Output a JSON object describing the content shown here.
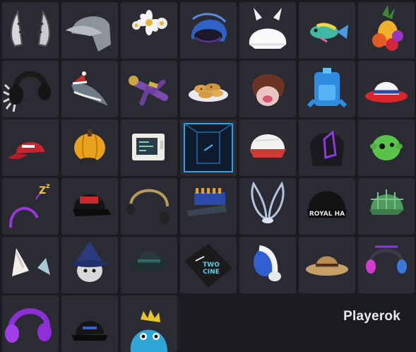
{
  "watermark": {
    "text": "Playerok"
  },
  "items": [
    {
      "icon": "horn-accessory-icon"
    },
    {
      "icon": "gray-hood-cap-icon"
    },
    {
      "icon": "daisy-flower-crown-icon"
    },
    {
      "icon": "blue-knit-helmet-icon"
    },
    {
      "icon": "white-devil-horns-icon"
    },
    {
      "icon": "rainbow-fish-icon"
    },
    {
      "icon": "fruit-hat-icon"
    },
    {
      "icon": "spiked-headphones-icon"
    },
    {
      "icon": "santa-shark-icon"
    },
    {
      "icon": "flying-ninja-icon"
    },
    {
      "icon": "cookie-plate-icon"
    },
    {
      "icon": "brown-hair-face-icon"
    },
    {
      "icon": "blue-backpack-icon"
    },
    {
      "icon": "white-red-fedora-icon"
    },
    {
      "icon": "red-cap-icon"
    },
    {
      "icon": "pumpkin-icon"
    },
    {
      "icon": "retro-computer-icon"
    },
    {
      "icon": "blue-box-icon"
    },
    {
      "icon": "white-red-cap-icon"
    },
    {
      "icon": "purple-visor-helmet-icon"
    },
    {
      "icon": "green-alien-head-icon"
    },
    {
      "icon": "sleepy-headband-icon"
    },
    {
      "icon": "black-stp-cap-icon"
    },
    {
      "icon": "gold-headset-icon"
    },
    {
      "icon": "bullet-cap-icon"
    },
    {
      "icon": "angel-wings-icon"
    },
    {
      "icon": "black-royal-cap-icon"
    },
    {
      "icon": "green-plaid-cap-icon"
    },
    {
      "icon": "cat-ears-icon"
    },
    {
      "icon": "wizard-cat-icon"
    },
    {
      "icon": "dark-fedora-icon"
    },
    {
      "icon": "sticker-cap-icon"
    },
    {
      "icon": "blue-white-headphones-icon"
    },
    {
      "icon": "straw-hat-icon"
    },
    {
      "icon": "rgb-headphones-icon"
    },
    {
      "icon": "purple-headphones-icon"
    },
    {
      "icon": "black-cap-icon"
    },
    {
      "icon": "blue-dino-hood-icon"
    }
  ]
}
